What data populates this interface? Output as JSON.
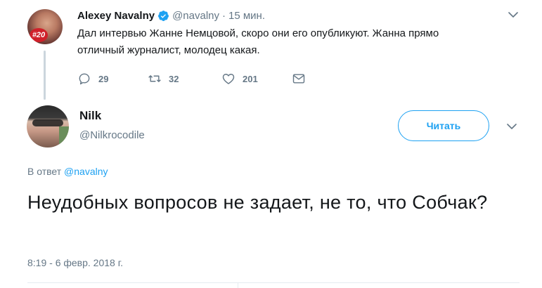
{
  "parent_tweet": {
    "author_name": "Alexey Navalny",
    "author_handle": "@navalny",
    "separator": "·",
    "time": "15 мин.",
    "avatar_badge": "#20",
    "text": "Дал интервью Жанне Немцовой, скоро они его опубликуют. Жанна прямо отличный журналист, молодец какая.",
    "actions": {
      "replies": "29",
      "retweets": "32",
      "likes": "201"
    }
  },
  "main_tweet": {
    "author_name": "Nilk",
    "author_handle": "@Nilkrocodile",
    "follow_label": "Читать",
    "reply_prefix": "В ответ",
    "reply_to_handle": "@navalny",
    "text": "Неудобных вопросов не задает, не то, что Собчак?",
    "date": "8:19 - 6 февр. 2018 г."
  },
  "colors": {
    "accent": "#1da1f2",
    "muted": "#657786",
    "text": "#14171a",
    "border": "#e6ecf0"
  },
  "icons": [
    "verified-badge-icon",
    "chevron-down-icon",
    "reply-icon",
    "retweet-icon",
    "like-heart-icon",
    "direct-message-icon"
  ]
}
